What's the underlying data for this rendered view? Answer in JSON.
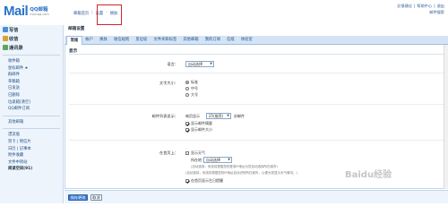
{
  "logo": {
    "main": "Mail",
    "brand": "QQ邮箱",
    "domain": "mail.qq.com"
  },
  "header": {
    "user_links": [
      "邮箱首页",
      "设置",
      "换肤"
    ],
    "top_right_links": [
      "反馈建议",
      "帮助中心",
      "退出"
    ],
    "top_right_search": "邮件搜索"
  },
  "sidebar": {
    "actions": [
      "写信",
      "收信",
      "通讯录"
    ],
    "folders": [
      "收件箱",
      "星标邮件 ★",
      "群邮件",
      "草稿箱",
      "已发送",
      "已删除",
      "垃圾箱[清空]",
      "QQ邮件订阅"
    ],
    "other_title": "其他邮箱",
    "other": [
      "漂流瓶",
      "贺卡 | 明信片",
      "日历 | 记事本",
      "附件收藏",
      "文件中转站",
      "阅读空间(91)"
    ]
  },
  "panel": {
    "title": "邮箱设置",
    "tabs": [
      "常规",
      "帐户",
      "换肤",
      "收信规则",
      "反垃圾",
      "文件夹和标签",
      "其他邮箱",
      "我的订阅",
      "信纸",
      "体验室"
    ],
    "active_tab": "常规"
  },
  "settings": {
    "section": "显示",
    "language_label": "语言：",
    "language_value": "自动选择",
    "font_label": "文字大小：",
    "font_options": [
      "标准",
      "中号",
      "大号"
    ],
    "font_selected": "标准",
    "list_label": "邮件列表显示：",
    "per_page_label": "每页显示",
    "per_page_value": "25(推荐)",
    "per_page_suffix": "封邮件",
    "show_summary": "显示邮件摘要",
    "show_size": "显示邮件大小",
    "home_label": "在首页上：",
    "show_weather": "显示天气",
    "city_label": "所在地：",
    "city_value": "自动选择",
    "city_note": "(自动选择：系统将根据您的登录IP地址为您自动选择所在城市)",
    "hint_note": "(自动选择，系统将根据您的IP地址自动识别所在城市，以便为您显示天气情况。)",
    "show_reminder": "在首页显示生日提醒"
  },
  "buttons": {
    "save": "保存更改",
    "cancel": "取消"
  },
  "watermark": "Baidu经验"
}
